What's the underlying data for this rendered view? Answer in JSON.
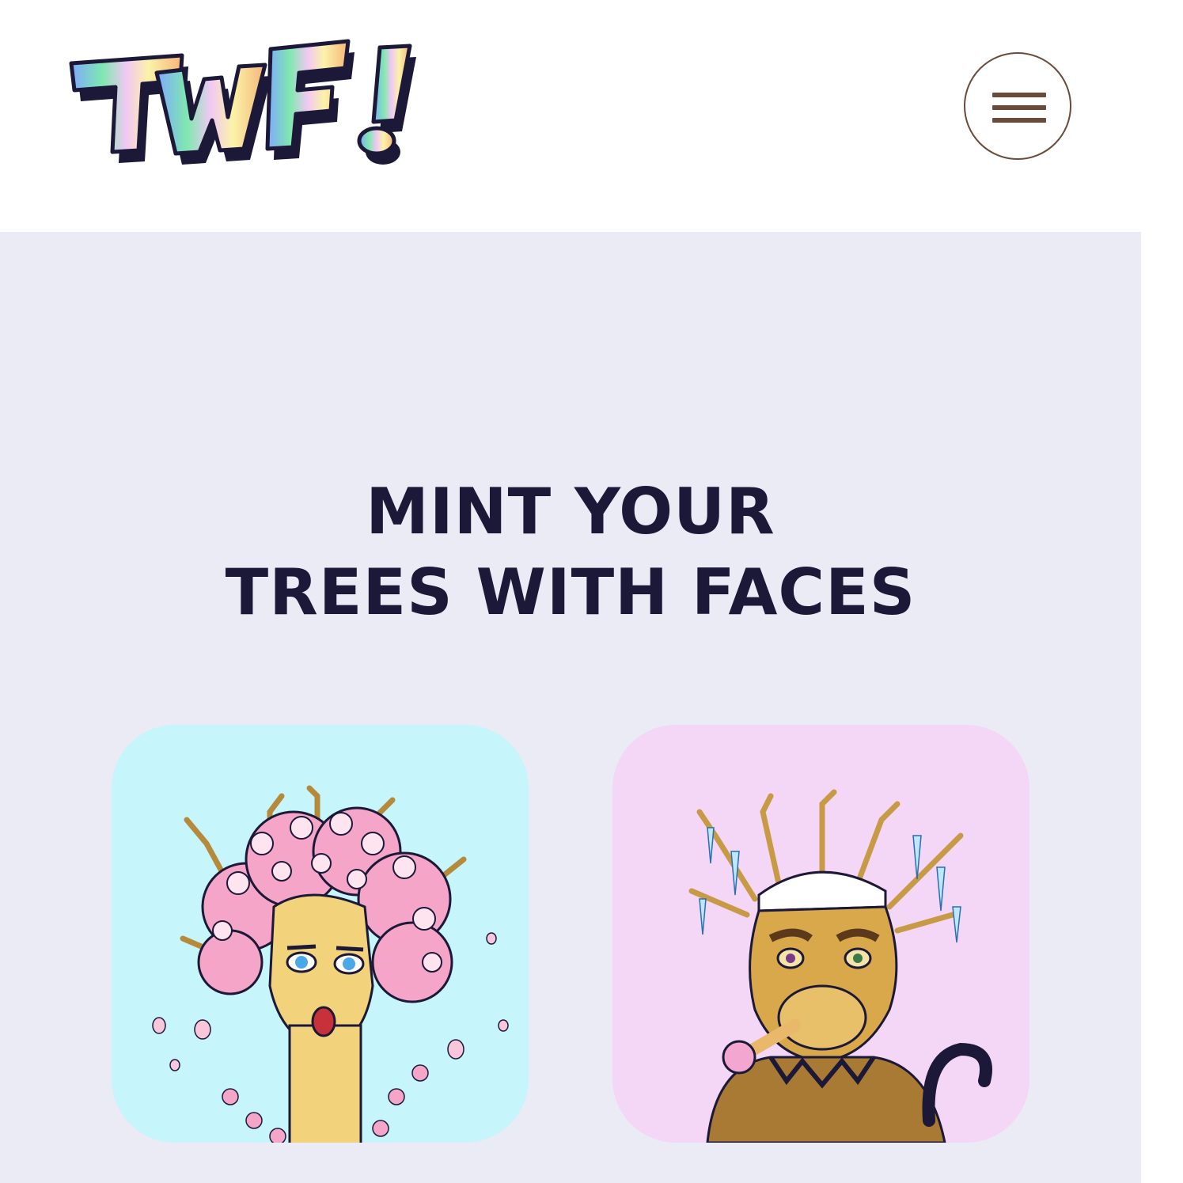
{
  "header": {
    "logo_text": "TWF!",
    "menu_button_icon": "hamburger-icon"
  },
  "hero": {
    "title_line1": "MINT YOUR",
    "title_line2": "TREES WITH FACES"
  },
  "cards": [
    {
      "name": "blossom-tree-face",
      "background": "#c6f5fb"
    },
    {
      "name": "frozen-monkey-tree-face",
      "background": "#f4d6f6"
    }
  ],
  "colors": {
    "title": "#1b1838",
    "hero_background": "#ebebf5",
    "menu_accent": "#6b4a3a"
  }
}
